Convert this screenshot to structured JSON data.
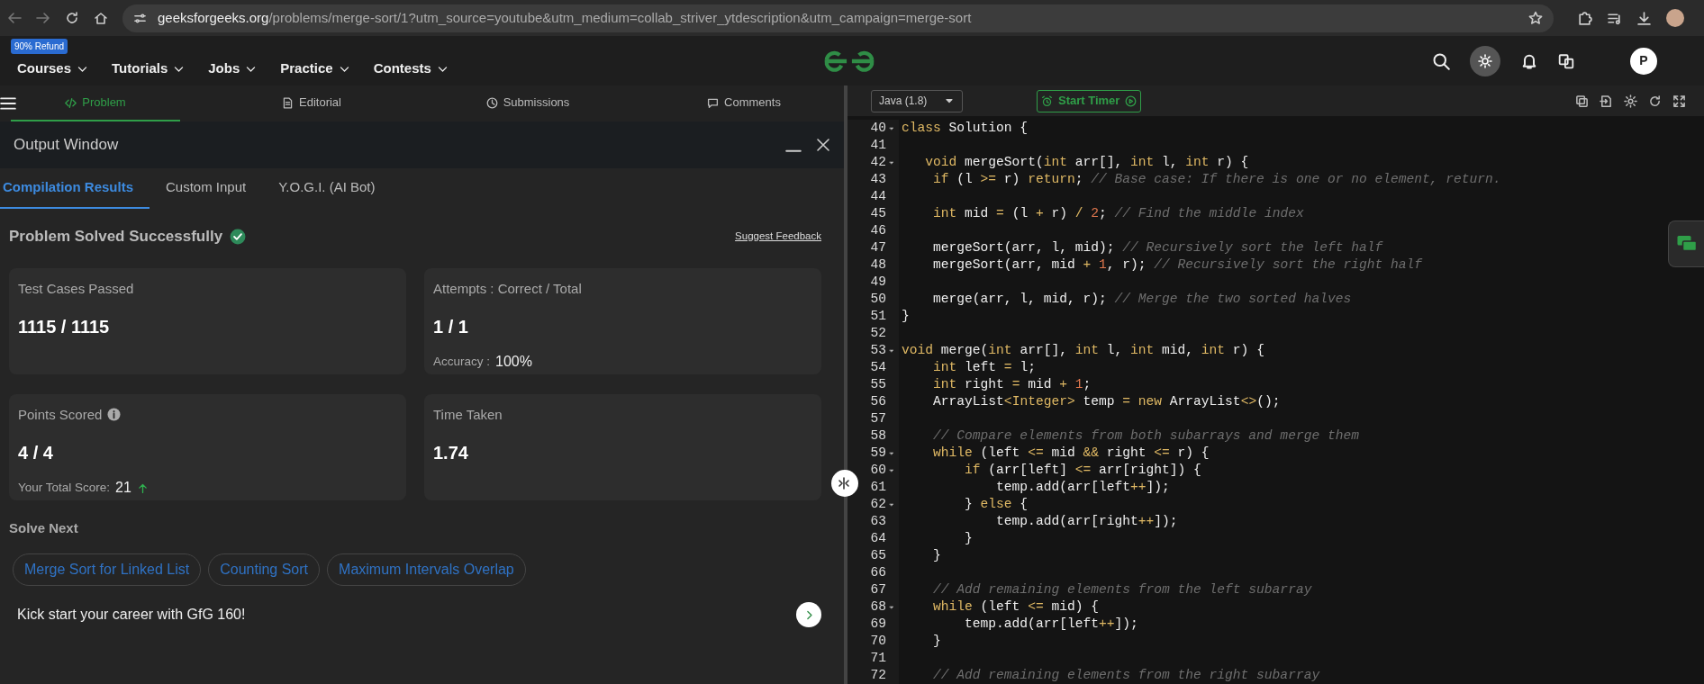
{
  "browser": {
    "url_domain": "geeksforgeeks.org",
    "url_path": "/problems/merge-sort/1?utm_source=youtube&utm_medium=collab_striver_ytdescription&utm_campaign=merge-sort"
  },
  "site_nav": {
    "badge": "90% Refund",
    "items": [
      {
        "label": "Courses"
      },
      {
        "label": "Tutorials"
      },
      {
        "label": "Jobs"
      },
      {
        "label": "Practice"
      },
      {
        "label": "Contests"
      }
    ],
    "avatar": "P"
  },
  "problem_tabs": [
    {
      "label": "Problem",
      "selected": true,
      "kind": "code"
    },
    {
      "label": "Editorial",
      "selected": false,
      "kind": "doc"
    },
    {
      "label": "Submissions",
      "selected": false,
      "kind": "clock"
    },
    {
      "label": "Comments",
      "selected": false,
      "kind": "chat"
    }
  ],
  "output": {
    "title": "Output Window",
    "tabs": [
      {
        "label": "Compilation Results",
        "selected": true
      },
      {
        "label": "Custom Input",
        "selected": false
      },
      {
        "label": "Y.O.G.I. (AI Bot)",
        "selected": false
      }
    ],
    "status": "Problem Solved Successfully",
    "feedback_link": "Suggest Feedback",
    "stats": [
      {
        "label": "Test Cases Passed",
        "value": "1115 / 1115"
      },
      {
        "label": "Attempts : Correct / Total",
        "value": "1 / 1",
        "sub_label": "Accuracy :",
        "sub_value": "100%"
      },
      {
        "label": "Points Scored",
        "info": true,
        "value": "4 / 4",
        "sub_label": "Your Total Score:",
        "sub_value": "21",
        "rising": true
      },
      {
        "label": "Time Taken",
        "value": "1.74"
      }
    ],
    "solve_next_title": "Solve Next",
    "suggestions": [
      {
        "label": "Merge Sort for Linked List"
      },
      {
        "label": "Counting Sort"
      },
      {
        "label": "Maximum Intervals Overlap"
      }
    ],
    "promo": "Kick start your career with GfG 160!"
  },
  "editor": {
    "language": "Java (1.8)",
    "timer_button": "Start Timer",
    "lines": [
      {
        "number": "40",
        "fold": true,
        "tokens": [
          {
            "kind": "keyword",
            "text": "class"
          },
          {
            "kind": "plain",
            "text": " Solution {"
          }
        ]
      },
      {
        "number": "41",
        "fold": false
      },
      {
        "number": "42",
        "fold": true,
        "tokens": [
          {
            "kind": "keyword",
            "text": "   void"
          },
          {
            "kind": "plain",
            "text": " mergeSort("
          },
          {
            "kind": "keyword",
            "text": "int"
          },
          {
            "kind": "plain",
            "text": " arr[], "
          },
          {
            "kind": "keyword",
            "text": "int"
          },
          {
            "kind": "plain",
            "text": " l, "
          },
          {
            "kind": "keyword",
            "text": "int"
          },
          {
            "kind": "plain",
            "text": " r) {"
          }
        ]
      },
      {
        "number": "43",
        "fold": false,
        "tokens": [
          {
            "kind": "keyword",
            "text": "    if"
          },
          {
            "kind": "plain",
            "text": " (l "
          },
          {
            "kind": "operator",
            "text": ">="
          },
          {
            "kind": "plain",
            "text": " r) "
          },
          {
            "kind": "keyword",
            "text": "return"
          },
          {
            "kind": "plain",
            "text": "; "
          },
          {
            "kind": "comment",
            "text": "// Base case: If there is one or no element, return."
          }
        ]
      },
      {
        "number": "44",
        "fold": false
      },
      {
        "number": "45",
        "fold": false,
        "tokens": [
          {
            "kind": "keyword",
            "text": "    int"
          },
          {
            "kind": "plain",
            "text": " mid "
          },
          {
            "kind": "operator",
            "text": "="
          },
          {
            "kind": "plain",
            "text": " (l "
          },
          {
            "kind": "operator",
            "text": "+"
          },
          {
            "kind": "plain",
            "text": " r) "
          },
          {
            "kind": "operator",
            "text": "/ "
          },
          {
            "kind": "number",
            "text": "2"
          },
          {
            "kind": "plain",
            "text": "; "
          },
          {
            "kind": "comment",
            "text": "// Find the middle index"
          }
        ]
      },
      {
        "number": "46",
        "fold": false
      },
      {
        "number": "47",
        "fold": false,
        "tokens": [
          {
            "kind": "plain",
            "text": "    mergeSort(arr, l, mid); "
          },
          {
            "kind": "comment",
            "text": "// Recursively sort the left half"
          }
        ]
      },
      {
        "number": "48",
        "fold": false,
        "tokens": [
          {
            "kind": "plain",
            "text": "    mergeSort(arr, mid "
          },
          {
            "kind": "operator",
            "text": "+ "
          },
          {
            "kind": "number",
            "text": "1"
          },
          {
            "kind": "plain",
            "text": ", r); "
          },
          {
            "kind": "comment",
            "text": "// Recursively sort the right half"
          }
        ]
      },
      {
        "number": "49",
        "fold": false
      },
      {
        "number": "50",
        "fold": false,
        "tokens": [
          {
            "kind": "plain",
            "text": "    merge(arr, l, mid, r); "
          },
          {
            "kind": "comment",
            "text": "// Merge the two sorted halves"
          }
        ]
      },
      {
        "number": "51",
        "fold": false,
        "tokens": [
          {
            "kind": "plain",
            "text": "}"
          }
        ]
      },
      {
        "number": "52",
        "fold": false
      },
      {
        "number": "53",
        "fold": true,
        "tokens": [
          {
            "kind": "keyword",
            "text": "void"
          },
          {
            "kind": "plain",
            "text": " merge("
          },
          {
            "kind": "keyword",
            "text": "int"
          },
          {
            "kind": "plain",
            "text": " arr[], "
          },
          {
            "kind": "keyword",
            "text": "int"
          },
          {
            "kind": "plain",
            "text": " l, "
          },
          {
            "kind": "keyword",
            "text": "int"
          },
          {
            "kind": "plain",
            "text": " mid, "
          },
          {
            "kind": "keyword",
            "text": "int"
          },
          {
            "kind": "plain",
            "text": " r) {"
          }
        ]
      },
      {
        "number": "54",
        "fold": false,
        "tokens": [
          {
            "kind": "keyword",
            "text": "    int"
          },
          {
            "kind": "plain",
            "text": " left "
          },
          {
            "kind": "operator",
            "text": "="
          },
          {
            "kind": "plain",
            "text": " l;"
          }
        ]
      },
      {
        "number": "55",
        "fold": false,
        "tokens": [
          {
            "kind": "keyword",
            "text": "    int"
          },
          {
            "kind": "plain",
            "text": " right "
          },
          {
            "kind": "operator",
            "text": "="
          },
          {
            "kind": "plain",
            "text": " mid "
          },
          {
            "kind": "operator",
            "text": "+ "
          },
          {
            "kind": "number",
            "text": "1"
          },
          {
            "kind": "plain",
            "text": ";"
          }
        ]
      },
      {
        "number": "56",
        "fold": false,
        "tokens": [
          {
            "kind": "plain",
            "text": "    ArrayList"
          },
          {
            "kind": "operator",
            "text": "<"
          },
          {
            "kind": "keyword",
            "text": "Integer"
          },
          {
            "kind": "operator",
            "text": ">"
          },
          {
            "kind": "plain",
            "text": " temp "
          },
          {
            "kind": "operator",
            "text": "= "
          },
          {
            "kind": "keyword",
            "text": "new"
          },
          {
            "kind": "plain",
            "text": " ArrayList"
          },
          {
            "kind": "operator",
            "text": "<>"
          },
          {
            "kind": "plain",
            "text": "();"
          }
        ]
      },
      {
        "number": "57",
        "fold": false
      },
      {
        "number": "58",
        "fold": false,
        "tokens": [
          {
            "kind": "comment",
            "text": "    // Compare elements from both subarrays and merge them"
          }
        ]
      },
      {
        "number": "59",
        "fold": true,
        "tokens": [
          {
            "kind": "keyword",
            "text": "    while"
          },
          {
            "kind": "plain",
            "text": " (left "
          },
          {
            "kind": "operator",
            "text": "<="
          },
          {
            "kind": "plain",
            "text": " mid "
          },
          {
            "kind": "operator",
            "text": "&&"
          },
          {
            "kind": "plain",
            "text": " right "
          },
          {
            "kind": "operator",
            "text": "<="
          },
          {
            "kind": "plain",
            "text": " r) {"
          }
        ]
      },
      {
        "number": "60",
        "fold": true,
        "tokens": [
          {
            "kind": "keyword",
            "text": "        if"
          },
          {
            "kind": "plain",
            "text": " (arr[left] "
          },
          {
            "kind": "operator",
            "text": "<="
          },
          {
            "kind": "plain",
            "text": " arr[right]) {"
          }
        ]
      },
      {
        "number": "61",
        "fold": false,
        "tokens": [
          {
            "kind": "plain",
            "text": "            temp.add(arr[left"
          },
          {
            "kind": "operator",
            "text": "++"
          },
          {
            "kind": "plain",
            "text": "]);"
          }
        ]
      },
      {
        "number": "62",
        "fold": true,
        "tokens": [
          {
            "kind": "plain",
            "text": "        } "
          },
          {
            "kind": "keyword",
            "text": "else"
          },
          {
            "kind": "plain",
            "text": " {"
          }
        ]
      },
      {
        "number": "63",
        "fold": false,
        "tokens": [
          {
            "kind": "plain",
            "text": "            temp.add(arr[right"
          },
          {
            "kind": "operator",
            "text": "++"
          },
          {
            "kind": "plain",
            "text": "]);"
          }
        ]
      },
      {
        "number": "64",
        "fold": false,
        "tokens": [
          {
            "kind": "plain",
            "text": "        }"
          }
        ]
      },
      {
        "number": "65",
        "fold": false,
        "tokens": [
          {
            "kind": "plain",
            "text": "    }"
          }
        ]
      },
      {
        "number": "66",
        "fold": false
      },
      {
        "number": "67",
        "fold": false,
        "tokens": [
          {
            "kind": "comment",
            "text": "    // Add remaining elements from the left subarray"
          }
        ]
      },
      {
        "number": "68",
        "fold": true,
        "tokens": [
          {
            "kind": "keyword",
            "text": "    while"
          },
          {
            "kind": "plain",
            "text": " (left "
          },
          {
            "kind": "operator",
            "text": "<="
          },
          {
            "kind": "plain",
            "text": " mid) {"
          }
        ]
      },
      {
        "number": "69",
        "fold": false,
        "tokens": [
          {
            "kind": "plain",
            "text": "        temp.add(arr[left"
          },
          {
            "kind": "operator",
            "text": "++"
          },
          {
            "kind": "plain",
            "text": "]);"
          }
        ]
      },
      {
        "number": "70",
        "fold": false,
        "tokens": [
          {
            "kind": "plain",
            "text": "    }"
          }
        ]
      },
      {
        "number": "71",
        "fold": false
      },
      {
        "number": "72",
        "fold": false,
        "tokens": [
          {
            "kind": "comment",
            "text": "    // Add remaining elements from the right subarray"
          }
        ]
      }
    ]
  }
}
